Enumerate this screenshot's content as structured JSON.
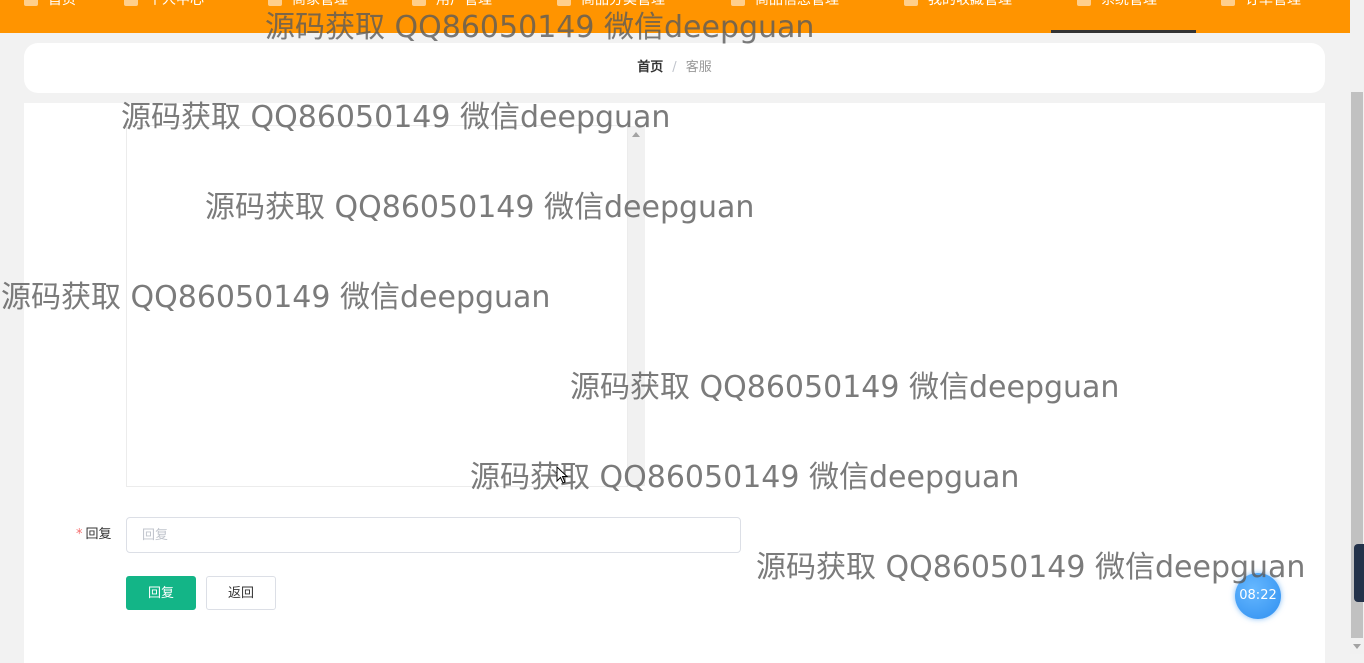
{
  "nav": {
    "items": [
      {
        "label": "首页"
      },
      {
        "label": "个人中心"
      },
      {
        "label": "商家管理"
      },
      {
        "label": "用户管理"
      },
      {
        "label": "商品分类管理"
      },
      {
        "label": "商品信息管理"
      },
      {
        "label": "我的收藏管理"
      },
      {
        "label": "系统管理"
      },
      {
        "label": "订单管理"
      }
    ],
    "active": "系统管理"
  },
  "breadcrumb": {
    "home": "首页",
    "separator": "/",
    "current": "客服"
  },
  "form": {
    "reply_label": "回复",
    "required_mark": "*",
    "reply_placeholder": "回复",
    "reply_value": ""
  },
  "buttons": {
    "submit": "回复",
    "back": "返回"
  },
  "clock": {
    "time": "08:22"
  },
  "watermarks": [
    "源码获取 QQ86050149 微信deepguan",
    "源码获取 QQ86050149 微信deepguan",
    "源码获取 QQ86050149 微信deepguan",
    "源码获取 QQ86050149 微信deepguan",
    "源码获取 QQ86050149 微信deepguan",
    "源码获取 QQ86050149 微信deepguan",
    "源码获取 QQ86050149 微信deepguan"
  ],
  "colors": {
    "nav_bg": "#ff9400",
    "primary": "#13b587",
    "required": "#f56c6c"
  }
}
